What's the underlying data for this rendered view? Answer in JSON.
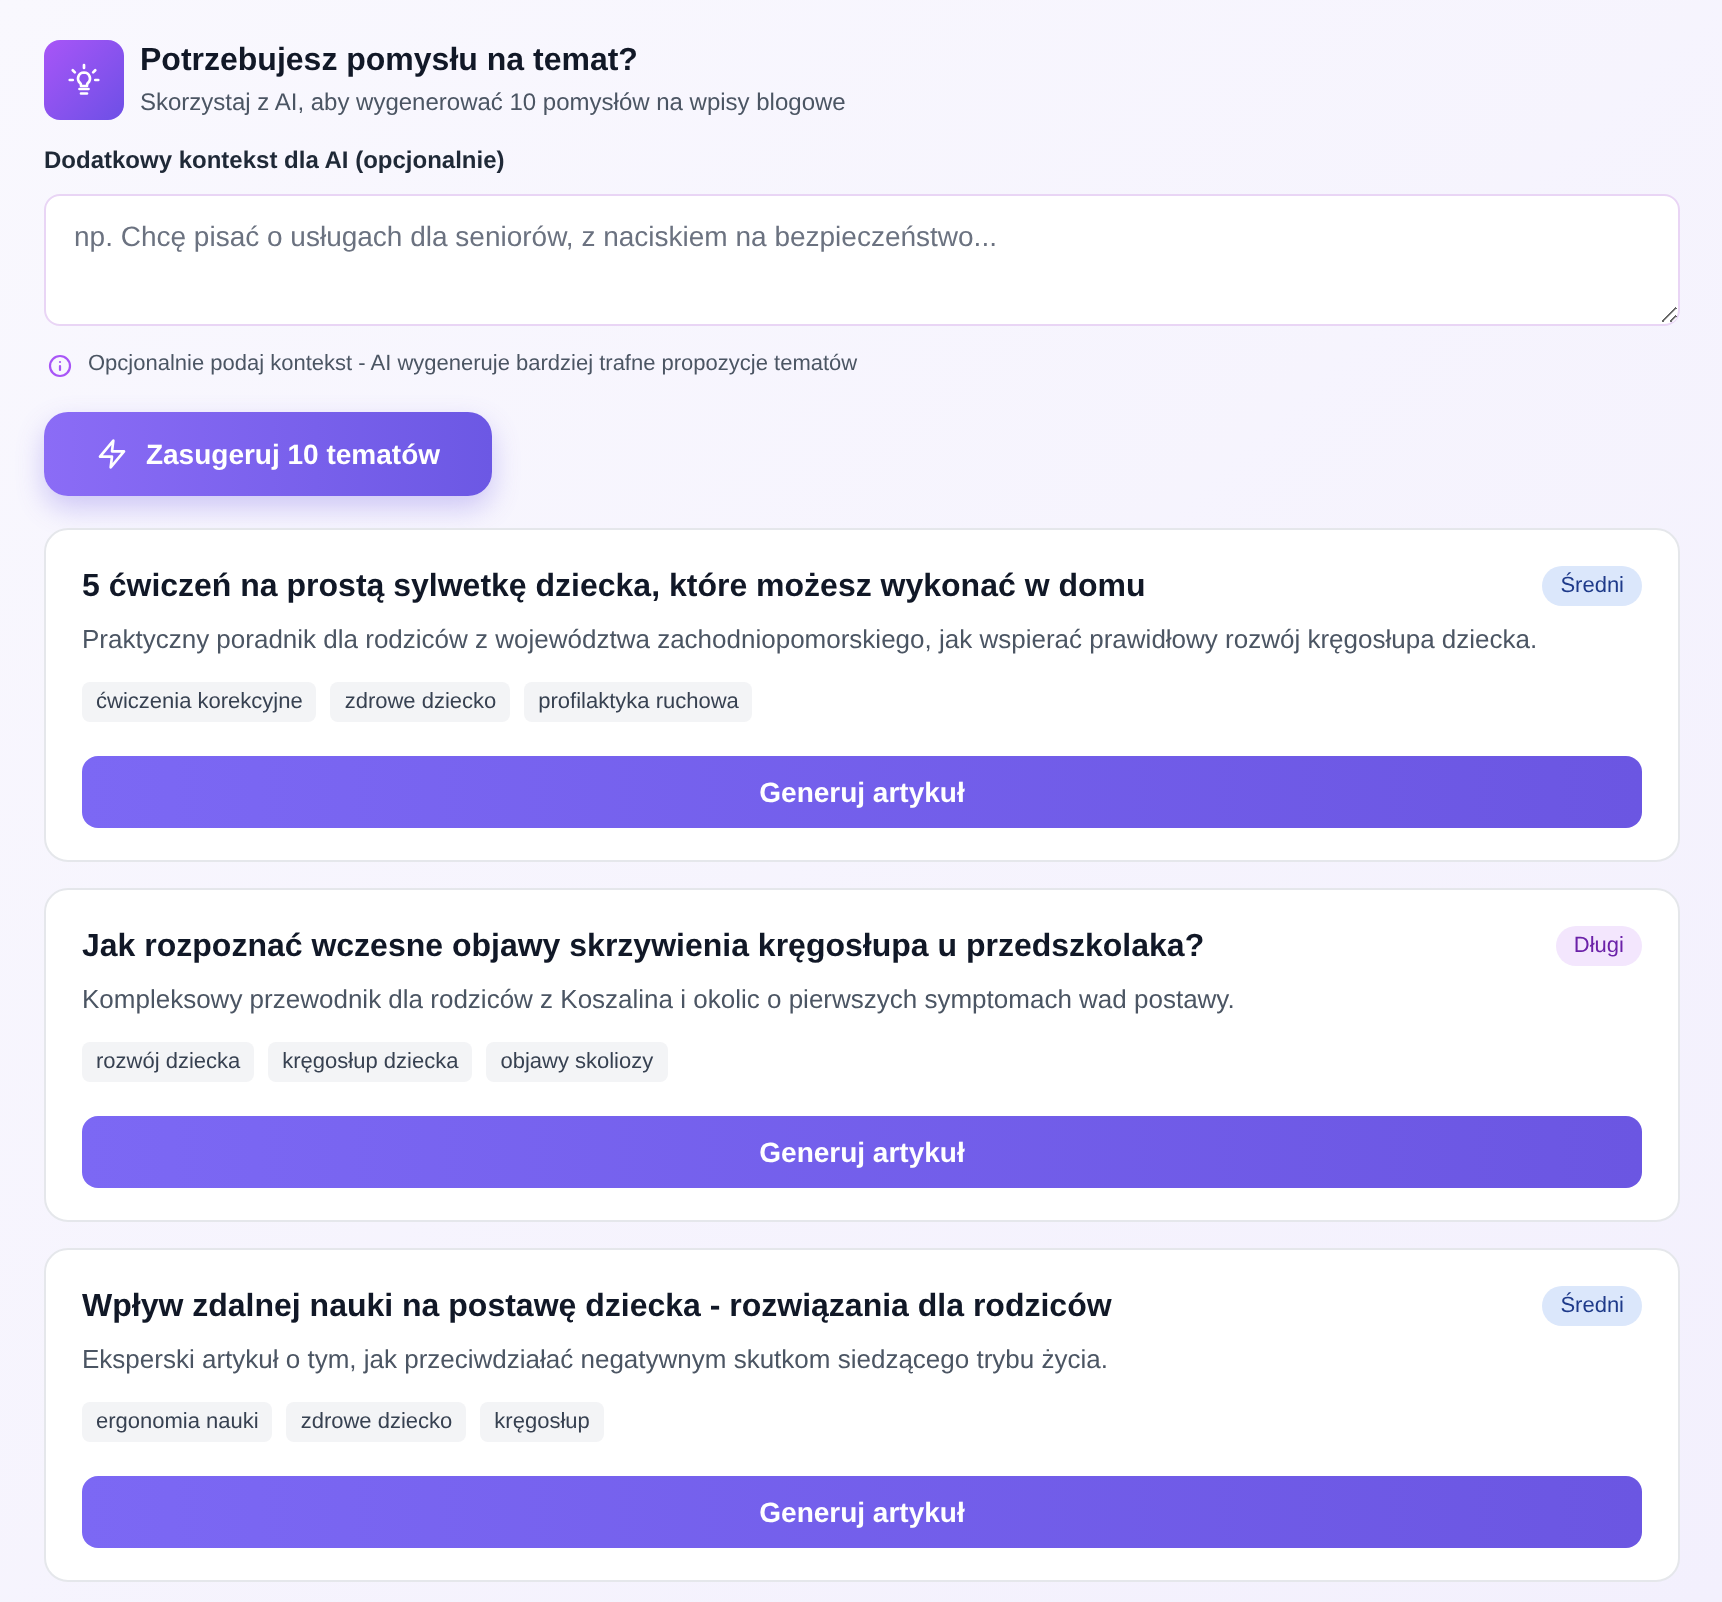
{
  "header": {
    "title": "Potrzebujesz pomysłu na temat?",
    "subtitle": "Skorzystaj z AI, aby wygenerować 10 pomysłów na wpisy blogowe"
  },
  "context": {
    "label": "Dodatkowy kontekst dla AI (opcjonalnie)",
    "placeholder": "np. Chcę pisać o usługach dla seniorów, z naciskiem na bezpieczeństwo...",
    "hint": "Opcjonalnie podaj kontekst - AI wygeneruje bardziej trafne propozycje tematów"
  },
  "suggest_button": "Zasugeruj 10 tematów",
  "ideas": [
    {
      "title": "5 ćwiczeń na prostą sylwetkę dziecka, które możesz wykonać w domu",
      "badge": {
        "label": "Średni",
        "kind": "medium"
      },
      "description": "Praktyczny poradnik dla rodziców z województwa zachodniopomorskiego, jak wspierać prawidłowy rozwój kręgosłupa dziecka.",
      "tags": [
        "ćwiczenia korekcyjne",
        "zdrowe dziecko",
        "profilaktyka ruchowa"
      ],
      "button": "Generuj artykuł"
    },
    {
      "title": "Jak rozpoznać wczesne objawy skrzywienia kręgosłupa u przedszkolaka?",
      "badge": {
        "label": "Długi",
        "kind": "long"
      },
      "description": "Kompleksowy przewodnik dla rodziców z Koszalina i okolic o pierwszych symptomach wad postawy.",
      "tags": [
        "rozwój dziecka",
        "kręgosłup dziecka",
        "objawy skoliozy"
      ],
      "button": "Generuj artykuł"
    },
    {
      "title": "Wpływ zdalnej nauki na postawę dziecka - rozwiązania dla rodziców",
      "badge": {
        "label": "Średni",
        "kind": "medium"
      },
      "description": "Eksperski artykuł o tym, jak przeciwdziałać negatywnym skutkom siedzącego trybu życia.",
      "tags": [
        "ergonomia nauki",
        "zdrowe dziecko",
        "kręgosłup"
      ],
      "button": "Generuj artykuł"
    }
  ]
}
